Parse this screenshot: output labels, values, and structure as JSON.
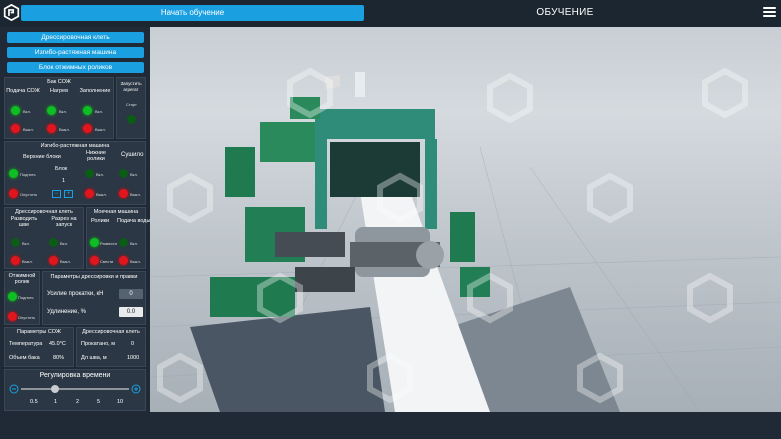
{
  "header": {
    "start_label": "Начать обучение",
    "mode_title": "ОБУЧЕНИЕ"
  },
  "nav": {
    "btn1": "Дрессировочная клеть",
    "btn2": "Изгибо-растяжная машина",
    "btn3": "Блок отжимных роликов"
  },
  "sozh_block": {
    "title": "Бак СОЖ",
    "cols": [
      "Подача СОЖ",
      "Нагрев",
      "Заполнение"
    ],
    "on": "Вкл.",
    "off": "Выкл.",
    "run_title": "Запустить агрегат",
    "start": "Старт"
  },
  "bend_machine": {
    "title": "Изгибо-растяжная машина",
    "upper_blocks": "Верхние блоки",
    "block": "Блок",
    "block_value": "1",
    "raise": "Поднять",
    "lower": "Опустить",
    "lower_rollers": "Нижние ролики",
    "on": "Вкл.",
    "off": "Выкл.",
    "dryer": "Сушило"
  },
  "mill_stand": {
    "title": "Дрессировочная клеть",
    "unwind": "Разводить шве",
    "cut": "Разрез на запуск",
    "on": "Вкл.",
    "off": "Выкл."
  },
  "wash": {
    "title": "Моечная машина",
    "rollers": "Ролики",
    "water": "Подача воды",
    "raise": "Развести",
    "lower": "Свести",
    "on": "Вкл.",
    "off": "Выкл."
  },
  "press_roller": {
    "title": "Отжимной ролик",
    "raise": "Поднять",
    "lower": "Опустить"
  },
  "params": {
    "title": "Параметры дрессировки и правки",
    "force_label": "Усилие прокатки, кН",
    "force_value": "0",
    "elong_label": "Удлинение, %",
    "elong_value": "0.0"
  },
  "sozh_params": {
    "title": "Параметры СОЖ",
    "temp_label": "Температура",
    "temp_value": "45.0°C",
    "tank_label": "Объем бака",
    "tank_value": "80%"
  },
  "mill_params": {
    "title": "Дрессировочная клеть",
    "rolled_label": "Прокатано, м",
    "rolled_value": "0",
    "step_label": "Дл шва, м",
    "step_value": "1000"
  },
  "time": {
    "title": "Регулировка времени",
    "ticks": [
      "0.5",
      "1",
      "2",
      "5",
      "10"
    ],
    "selected_index": 1
  }
}
